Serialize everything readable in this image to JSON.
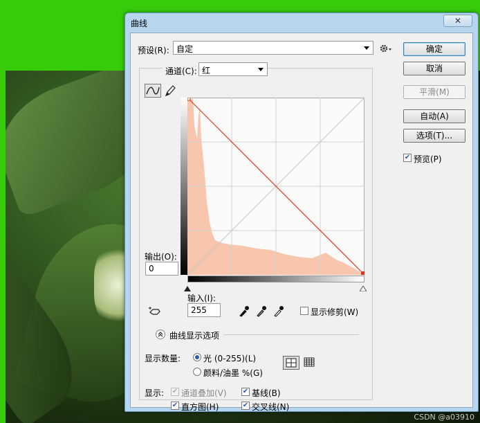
{
  "window": {
    "title": "曲线",
    "close_glyph": "✕"
  },
  "preset": {
    "label": "预设(R):",
    "value": "自定"
  },
  "channel": {
    "label": "通道(C):",
    "value": "红"
  },
  "buttons": {
    "ok": "确定",
    "cancel": "取消",
    "smooth": "平滑(M)",
    "auto": "自动(A)",
    "options": "选项(T)..."
  },
  "preview": {
    "label": "预览(P)",
    "checked": true
  },
  "output": {
    "label": "输出(O):",
    "value": "0"
  },
  "input": {
    "label": "输入(I):",
    "value": "255"
  },
  "show_clipping": {
    "label": "显示修剪(W)",
    "checked": false
  },
  "display_options": {
    "header": "曲线显示选项",
    "amount_label": "显示数量:",
    "light_label": "光 (0-255)(L)",
    "pigment_label": "颜料/油墨 %(G)",
    "show_label": "显示:",
    "channel_overlays": "通道叠加(V)",
    "baseline": "基线(B)",
    "histogram": "直方图(H)",
    "intersection": "交叉线(N)"
  },
  "colors": {
    "curve": "#d9381e",
    "histogram": "#f8c6ad",
    "background": "#36cc0a"
  },
  "watermark": "CSDN @a03910"
}
